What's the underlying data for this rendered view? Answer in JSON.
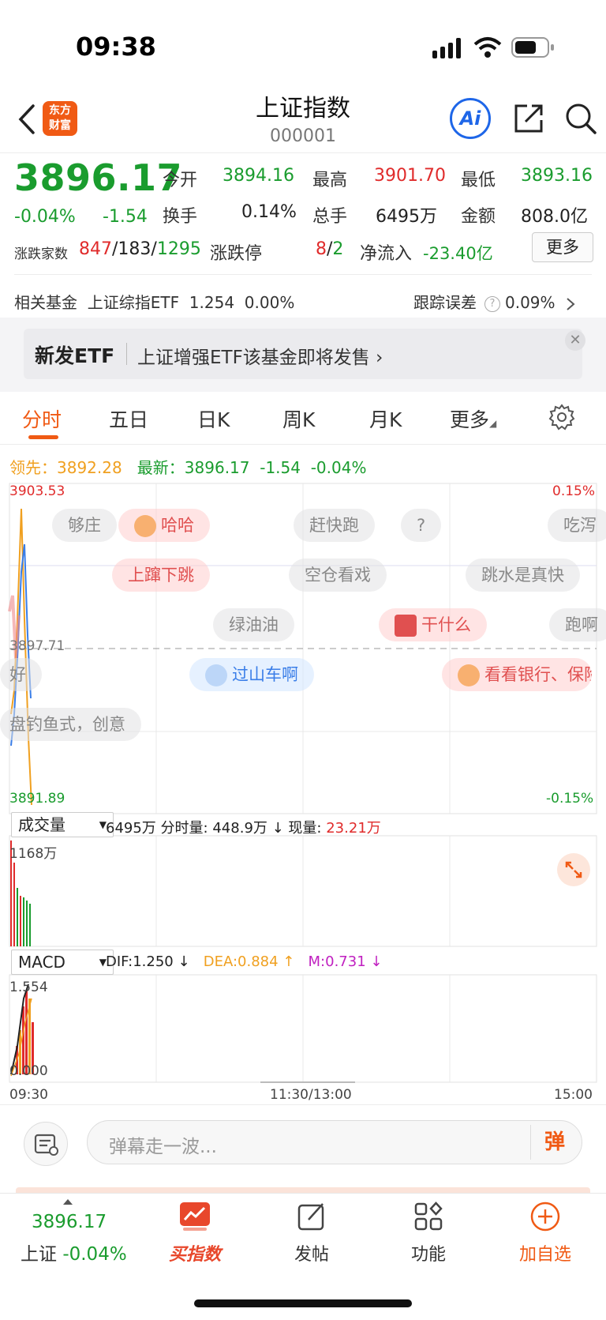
{
  "status": {
    "time": "09:38"
  },
  "header": {
    "logo_line1": "东方",
    "logo_line2": "财富",
    "title": "上证指数",
    "code": "000001",
    "ai_label": "Ai"
  },
  "quote": {
    "price": "3896.17",
    "change_pct": "-0.04%",
    "change_abs": "-1.54",
    "open_label": "今开",
    "open": "3894.16",
    "high_label": "最高",
    "high": "3901.70",
    "low_label": "最低",
    "low": "3893.16",
    "turnover_label": "换手",
    "turnover": "0.14%",
    "volume_label": "总手",
    "volume": "6495万",
    "amount_label": "金额",
    "amount": "808.0亿",
    "adv_label": "涨跌家数",
    "adv_up": "847",
    "adv_flat": "183",
    "adv_down": "1295",
    "limit_label": "涨跌停",
    "limit_up": "8",
    "limit_down": "2",
    "netflow_label": "净流入",
    "netflow": "-23.40亿",
    "more_label": "更多"
  },
  "fund": {
    "label": "相关基金",
    "name": "上证综指ETF",
    "price": "1.254",
    "pct": "0.00%",
    "track_label": "跟踪误差",
    "track_val": "0.09%"
  },
  "banner": {
    "tag": "新发ETF",
    "text": "上证增强ETF该基金即将发售"
  },
  "tabs": [
    "分时",
    "五日",
    "日K",
    "周K",
    "月K",
    "更多"
  ],
  "legend": {
    "lead_label": "领先：",
    "lead_val": "3892.28",
    "latest_label": "最新：",
    "latest_val": "3896.17",
    "latest_chg": "-1.54",
    "latest_pct": "-0.04%"
  },
  "chart": {
    "y_top": "3903.53",
    "y_mid": "3897.71",
    "y_bot": "3891.89",
    "pct_top": "0.15%",
    "pct_bot": "-0.15%",
    "vol_select": "成交量",
    "vol_total": "6495万",
    "vol_minute_label": "分时量:",
    "vol_minute": "448.9万",
    "vol_now_label": "现量:",
    "vol_now": "23.21万",
    "vol_max": "1168万",
    "macd_select": "MACD",
    "dif": "DIF:1.250",
    "dea": "DEA:0.884",
    "m": "M:0.731",
    "macd_top": "1.554",
    "macd_zero": "0.000",
    "time_start": "09:30",
    "time_mid": "11:30/13:00",
    "time_end": "15:00"
  },
  "danmu": [
    "够庄",
    "哈哈",
    "赶快跑",
    "?",
    "吃泻",
    "上蹿下跳",
    "空仓看戏",
    "跳水是真快",
    "绿油油",
    "干什么",
    "跑啊",
    "好",
    "过山车啊",
    "看看银行、保险",
    "盘钓鱼式，创意"
  ],
  "comment": {
    "placeholder": "弹幕走一波...",
    "toggle": "弹"
  },
  "nav": {
    "price": "3896.17",
    "index_name": "上证",
    "index_pct": "-0.04%",
    "buy": "买指数",
    "post": "发帖",
    "func": "功能",
    "watch": "加自选"
  },
  "colors": {
    "accent": "#f05a14",
    "up": "#e02b2b",
    "down": "#1a9c2e",
    "lead": "#f0a020"
  }
}
